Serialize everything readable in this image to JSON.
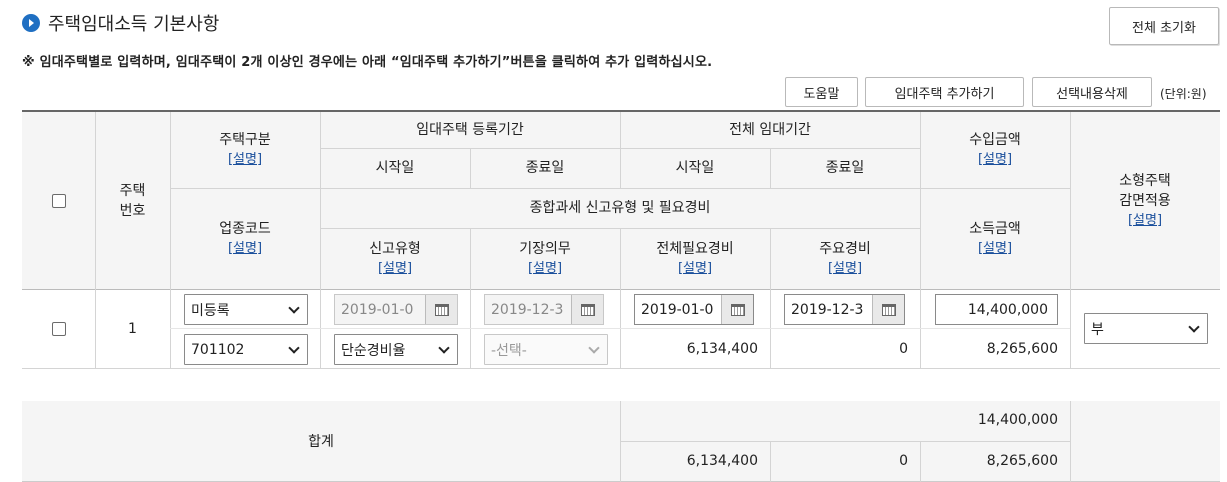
{
  "page": {
    "title": "주택임대소득 기본사항",
    "reset_button": "전체 초기화",
    "notice": "※ 임대주택별로 입력하며, 임대주택이 2개 이상인 경우에는 아래 “임대주택 추가하기”버튼을 클릭하여 추가 입력하십시오.",
    "help_button": "도움말",
    "add_button": "임대주택 추가하기",
    "delete_button": "선택내용삭제",
    "unit": "(단위:원)"
  },
  "header": {
    "house_no": "주택\n번호",
    "house_type": "주택구분",
    "rental_reg_period": "임대주택 등록기간",
    "total_rental_period": "전체 임대기간",
    "start_date": "시작일",
    "end_date": "종료일",
    "income_amount": "수입금액",
    "small_house": "소형주택\n감면적용",
    "tax_report": "종합과세 신고유형 및 필요경비",
    "industry_code": "업종코드",
    "report_type": "신고유형",
    "bookkeeping": "기장의무",
    "total_expense": "전체필요경비",
    "main_expense": "주요경비",
    "profit_amount": "소득금액",
    "explain": "[설명]"
  },
  "row": {
    "number": "1",
    "house_type": "미등록",
    "reg_start": "2019-01-0",
    "reg_end": "2019-12-3",
    "rent_start": "2019-01-0",
    "rent_end": "2019-12-3",
    "income": "14,400,000",
    "small_house": "부",
    "industry_code": "701102",
    "report_type": "단순경비율",
    "bookkeeping": "-선택-",
    "total_expense": "6,134,400",
    "main_expense": "0",
    "profit": "8,265,600"
  },
  "summary": {
    "label": "합계",
    "income": "14,400,000",
    "total_expense": "6,134,400",
    "main_expense": "0",
    "profit": "8,265,600"
  }
}
